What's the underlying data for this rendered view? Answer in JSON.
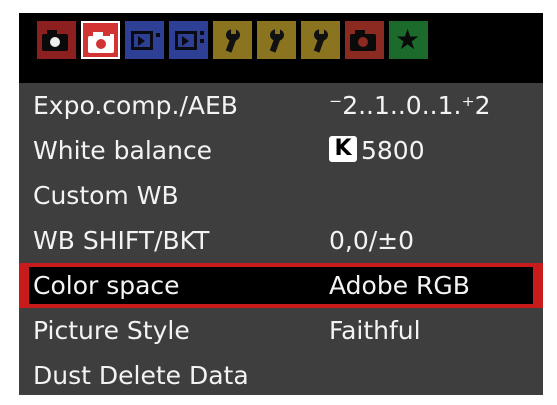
{
  "tabs": [
    {
      "name": "tab-shooting-1",
      "icon": "camera-icon",
      "active": false
    },
    {
      "name": "tab-shooting-2",
      "icon": "camera-icon",
      "active": true
    },
    {
      "name": "tab-playback-1",
      "icon": "playback-icon",
      "active": false
    },
    {
      "name": "tab-playback-2",
      "icon": "playback-icon",
      "active": false
    },
    {
      "name": "tab-setup-1",
      "icon": "wrench-icon",
      "active": false
    },
    {
      "name": "tab-setup-2",
      "icon": "wrench-icon",
      "active": false
    },
    {
      "name": "tab-setup-3",
      "icon": "wrench-icon",
      "active": false
    },
    {
      "name": "tab-custom-functions",
      "icon": "camera-icon",
      "active": false
    },
    {
      "name": "tab-my-menu",
      "icon": "star-icon",
      "active": false
    }
  ],
  "colors": {
    "accent": "#c81c1c",
    "row_background": "#3e3e3e",
    "text": "#f3f3f3"
  },
  "menu": {
    "items": [
      {
        "label": "Expo.comp./AEB",
        "value": "⁻2..1..0..1.⁺2"
      },
      {
        "label": "White balance",
        "badge": "K",
        "value": "5800"
      },
      {
        "label": "Custom WB",
        "value": ""
      },
      {
        "label": "WB SHIFT/BKT",
        "value": "0,0/±0"
      },
      {
        "label": "Color space",
        "value": "Adobe RGB",
        "selected": true
      },
      {
        "label": "Picture Style",
        "value": "Faithful"
      },
      {
        "label": "Dust Delete Data",
        "value": ""
      }
    ]
  }
}
